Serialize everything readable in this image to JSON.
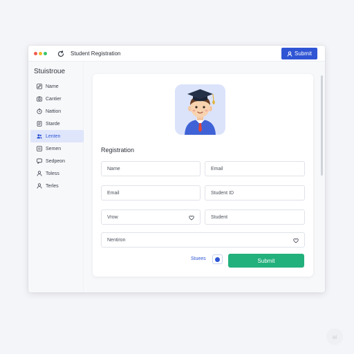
{
  "window": {
    "title": "Student Registration",
    "top_button_label": "Submit"
  },
  "sidebar": {
    "brand": "Stuistroue",
    "items": [
      {
        "label": "Name",
        "icon": "edit-icon",
        "active": false
      },
      {
        "label": "Cantier",
        "icon": "camera-icon",
        "active": false
      },
      {
        "label": "Nattion",
        "icon": "clock-icon",
        "active": false
      },
      {
        "label": "Starde",
        "icon": "document-icon",
        "active": false
      },
      {
        "label": "Lenten",
        "icon": "users-icon",
        "active": true
      },
      {
        "label": "Semen",
        "icon": "list-icon",
        "active": false
      },
      {
        "label": "Sedpeon",
        "icon": "chat-icon",
        "active": false
      },
      {
        "label": "Toless",
        "icon": "person-icon",
        "active": false
      },
      {
        "label": "Terles",
        "icon": "person-icon",
        "active": false
      }
    ]
  },
  "form": {
    "section_title": "Registration",
    "fields": {
      "name": "Name",
      "email_right": "Email",
      "email_left": "Email",
      "student_id": "Student ID",
      "vrow": "Vrow",
      "student": "Student",
      "nention": "Nentiron"
    },
    "link_label": "Stuees",
    "submit_label": "Submit"
  },
  "watermark": "ai",
  "colors": {
    "accent": "#2f55d4",
    "submit_green": "#22b07d",
    "dot_red": "#ef5b4e",
    "dot_yellow": "#f2b728",
    "dot_green": "#3cc46b"
  }
}
